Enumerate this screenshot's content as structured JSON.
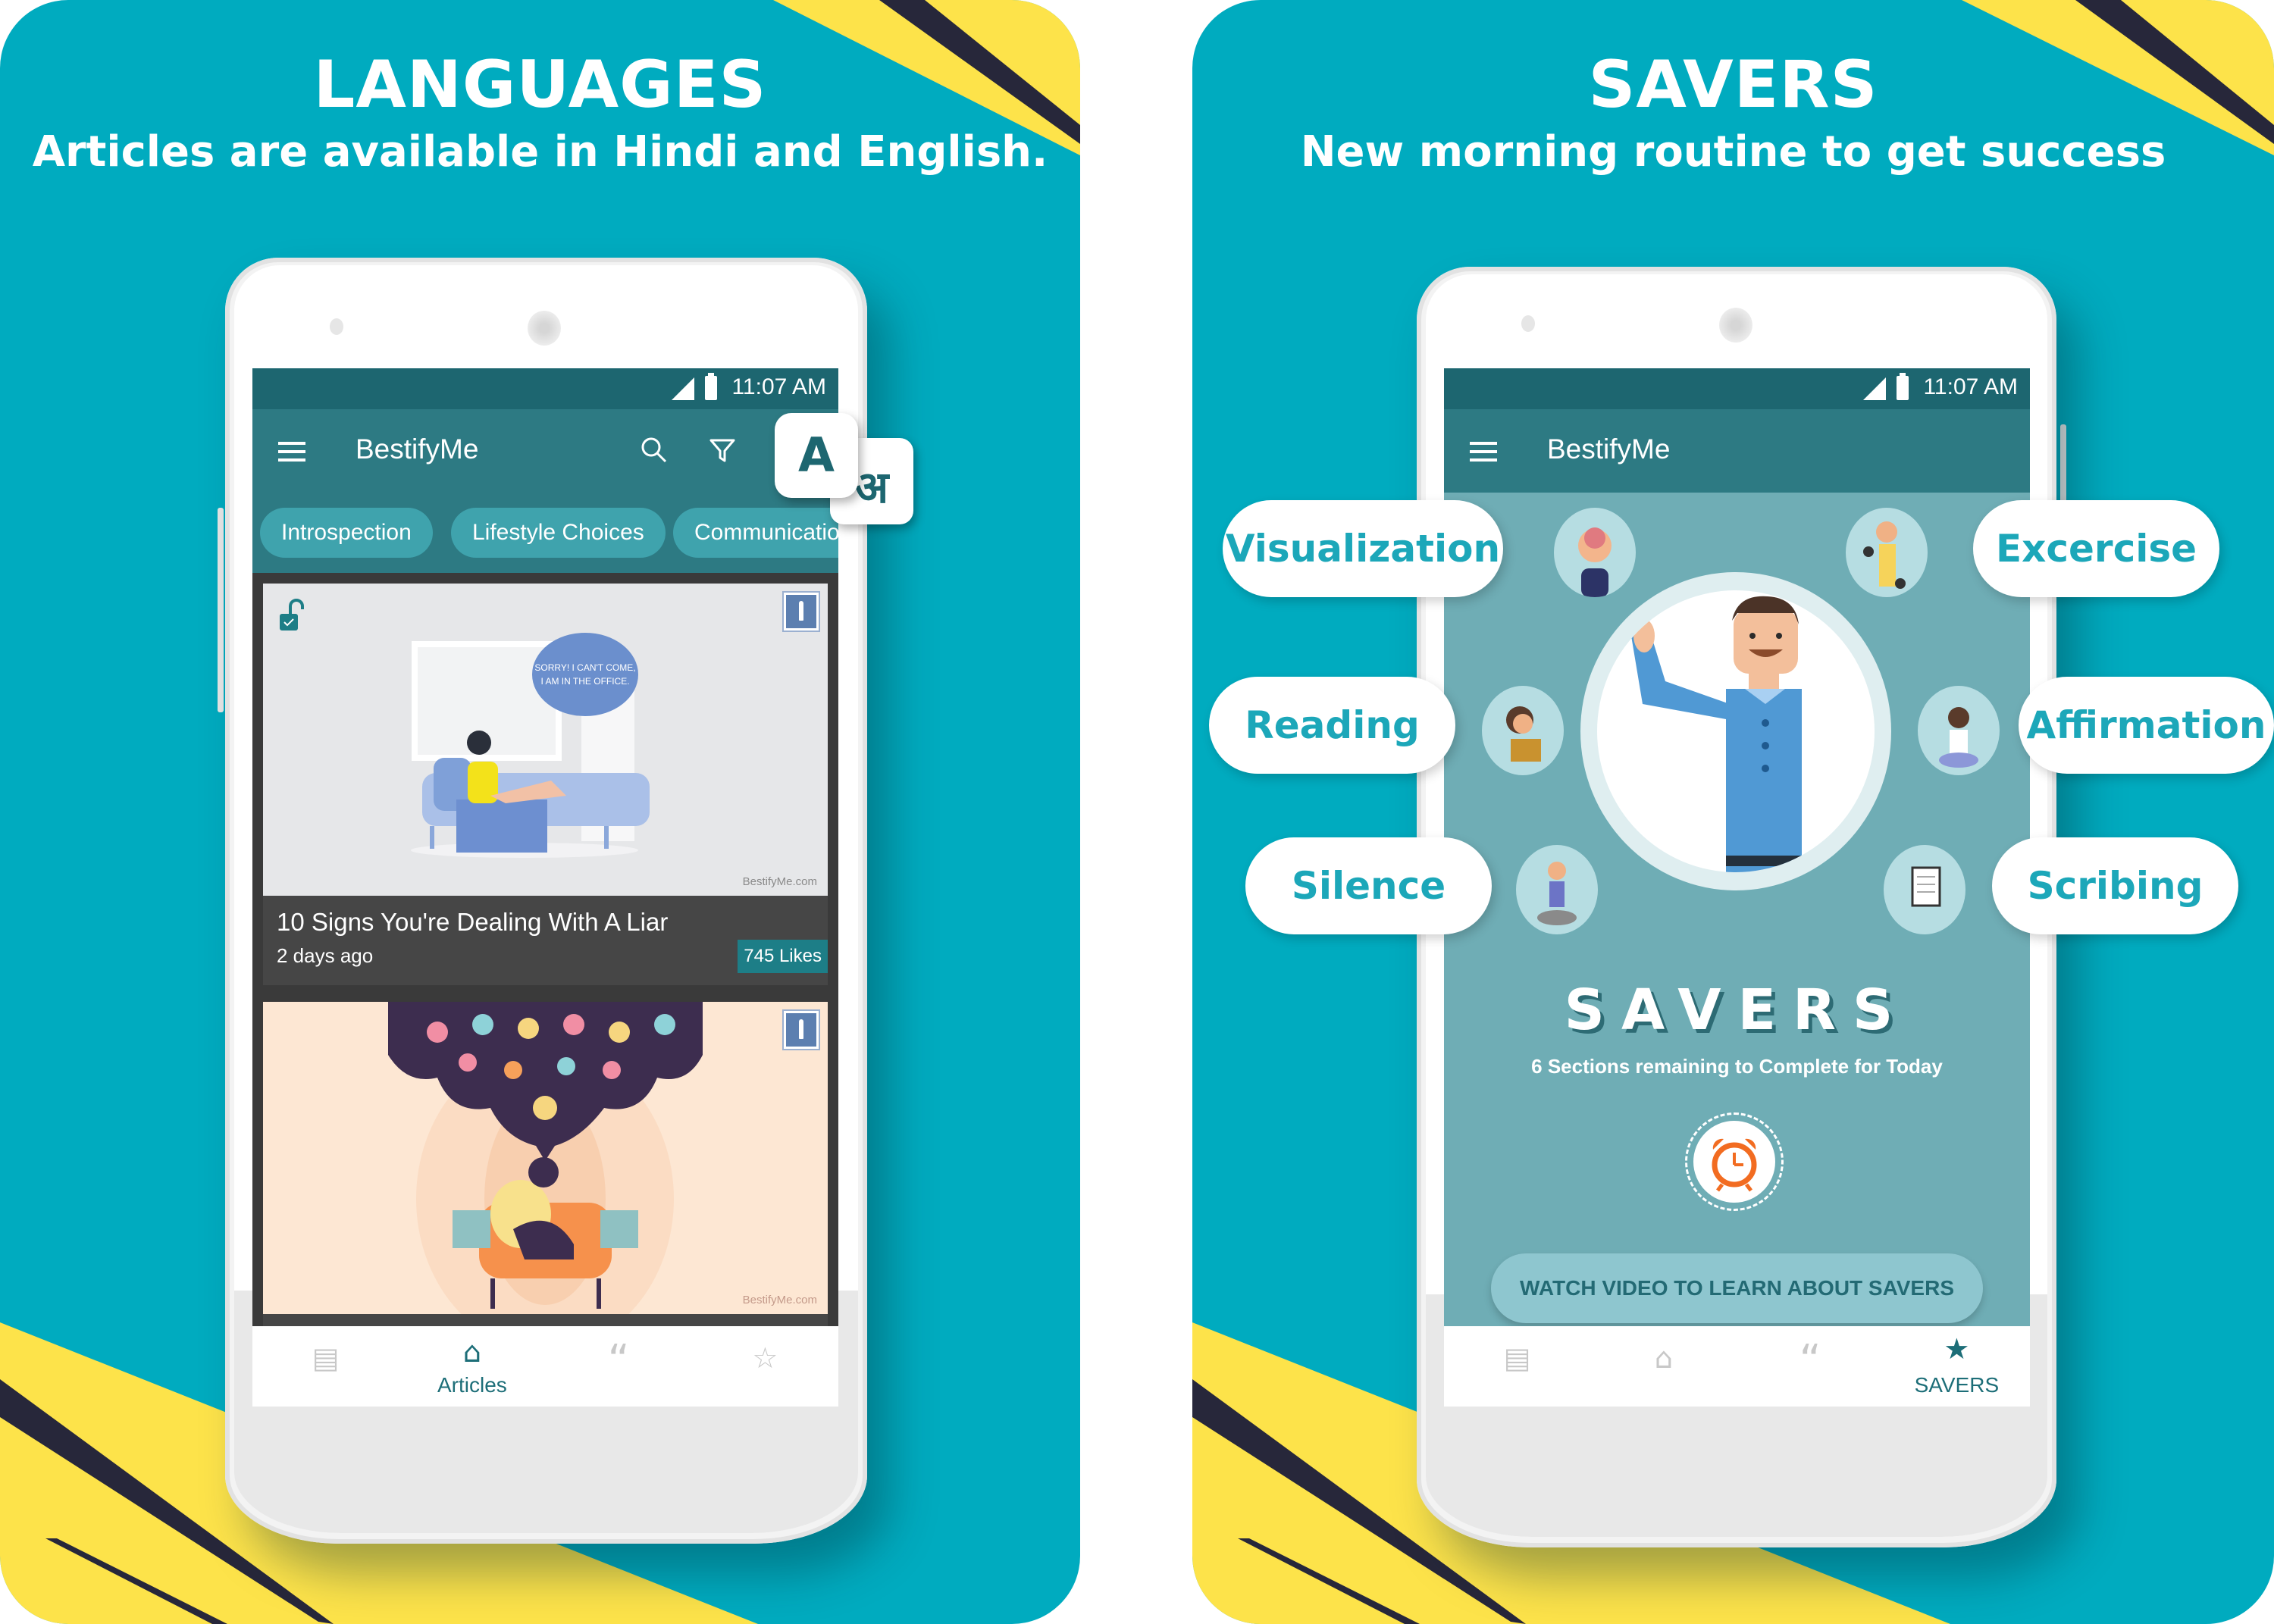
{
  "panels": [
    {
      "headline": "LANGUAGES",
      "subline": "Articles are available in Hindi and English.",
      "colors": {
        "background": "#00abbf",
        "stripe_yellow": "#fde34a",
        "stripe_navy": "#27273a"
      },
      "phone": {
        "status": {
          "time": "11:07 AM",
          "icons": [
            "signal-icon",
            "battery-charging-icon"
          ]
        },
        "toolbar": {
          "menu_icon": "hamburger-menu-icon",
          "title": "BestifyMe",
          "actions": [
            "search-icon",
            "filter-icon"
          ]
        },
        "language_keys": {
          "english": "A",
          "hindi": "अ"
        },
        "chips": [
          "Introspection",
          "Lifestyle Choices",
          "Communication"
        ],
        "articles": [
          {
            "title": "10 Signs You're Dealing With A Liar",
            "date": "2 days ago",
            "likes": "745 Likes",
            "speech_bubble": "SORRY! I CAN'T COME, I AM IN THE OFFICE.",
            "watermark": "BestifyMe.com",
            "unlocked": true
          },
          {
            "title": "",
            "date": "",
            "likes": "",
            "watermark": "BestifyMe.com"
          }
        ],
        "bottom_nav": [
          {
            "icon": "newspaper-icon",
            "label": "",
            "active": false
          },
          {
            "icon": "home-icon",
            "label": "Articles",
            "active": true
          },
          {
            "icon": "quote-icon",
            "label": "",
            "active": false
          },
          {
            "icon": "savers-person-icon",
            "label": "",
            "active": false
          }
        ]
      }
    },
    {
      "headline": "SAVERS",
      "subline": "New morning routine to get success",
      "phone": {
        "status": {
          "time": "11:07 AM",
          "icons": [
            "signal-icon",
            "battery-charging-icon"
          ]
        },
        "toolbar": {
          "menu_icon": "hamburger-menu-icon",
          "title": "BestifyMe"
        },
        "sections": [
          "Visualization",
          "Excercise",
          "Reading",
          "Affirmation",
          "Silence",
          "Scribing"
        ],
        "savers_title": "SAVERS",
        "remaining_text": "6 Sections remaining to Complete for Today",
        "sections_remaining": 6,
        "alarm_icon": "alarm-clock-icon",
        "watch_button": "WATCH VIDEO TO LEARN ABOUT SAVERS",
        "bottom_nav": [
          {
            "icon": "newspaper-icon",
            "label": "",
            "active": false
          },
          {
            "icon": "home-icon",
            "label": "",
            "active": false
          },
          {
            "icon": "quote-icon",
            "label": "",
            "active": false
          },
          {
            "icon": "savers-person-icon",
            "label": "SAVERS",
            "active": true
          }
        ]
      }
    }
  ]
}
